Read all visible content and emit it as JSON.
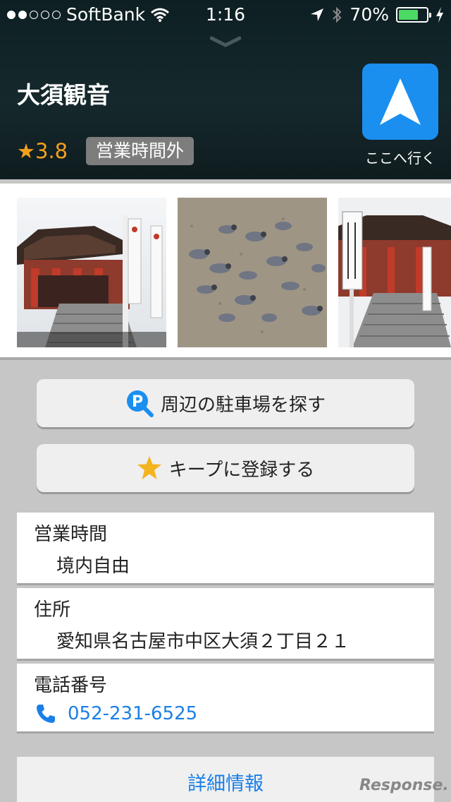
{
  "status_bar": {
    "carrier": "SoftBank",
    "time": "1:16",
    "battery": "70%",
    "battery_level": 0.7,
    "signal_bars": 2
  },
  "place": {
    "title": "大須観音",
    "rating": "3.8",
    "rating_star": "★",
    "status": "営業時間外",
    "nav_label": "ここへ行く"
  },
  "photos": [
    "temple",
    "pigeons",
    "temple-stairs"
  ],
  "actions": {
    "parking": "周辺の駐車場を探す",
    "keep": "キープに登録する"
  },
  "info": {
    "hours_label": "営業時間",
    "hours_value": "境内自由",
    "address_label": "住所",
    "address_value": "愛知県名古屋市中区大須２丁目２１",
    "phone_label": "電話番号",
    "phone_value": "052-231-6525"
  },
  "details_label": "詳細情報",
  "watermark": "Response.",
  "colors": {
    "accent": "#1a8ff0",
    "link": "#1a7fe6",
    "star": "#f4a11e",
    "battery": "#4cd964"
  }
}
